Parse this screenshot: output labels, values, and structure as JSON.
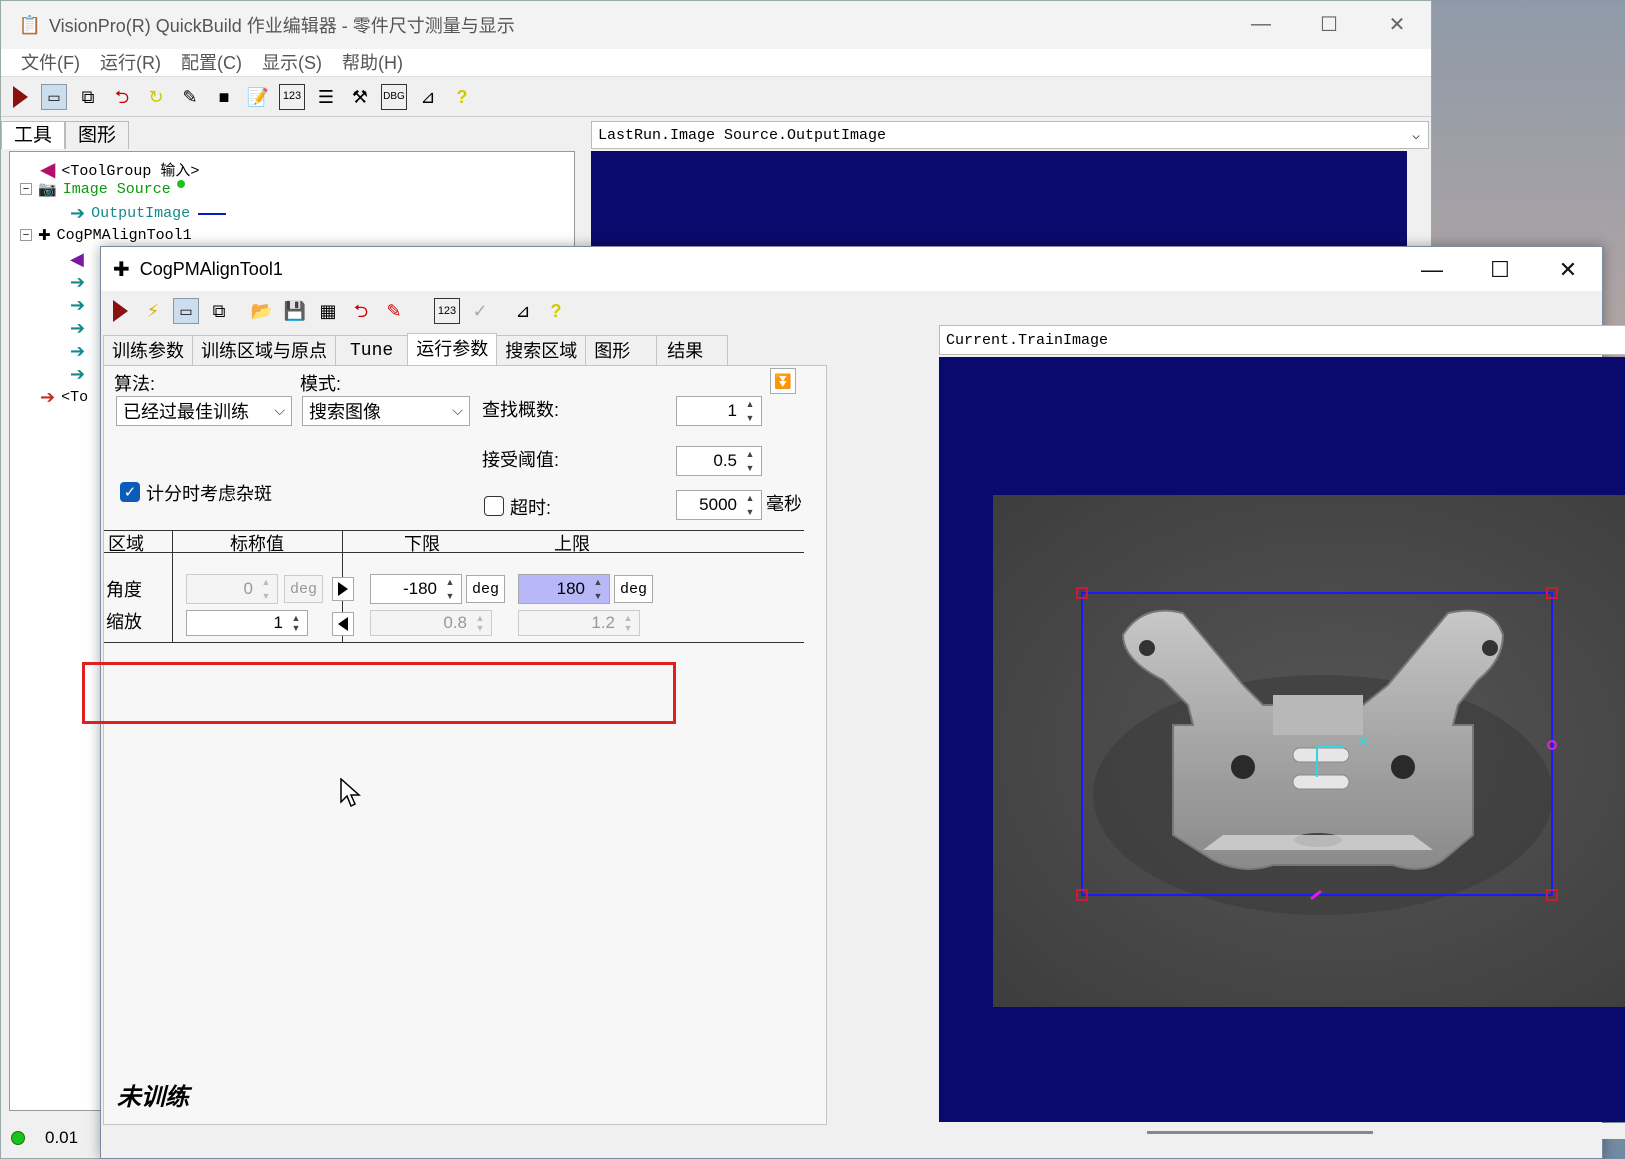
{
  "main_window": {
    "title": "VisionPro(R) QuickBuild 作业编辑器 - 零件尺寸测量与显示",
    "menu": [
      "文件(F)",
      "运行(R)",
      "配置(C)",
      "显示(S)",
      "帮助(H)"
    ],
    "tabs": [
      "工具",
      "图形"
    ],
    "tree": {
      "input": "<ToolGroup 输入>",
      "image_source": "Image Source",
      "output_image": "OutputImage",
      "pmalign": "CogPMAlignTool1",
      "output_stub": "<To"
    },
    "image_selector": "LastRun.Image Source.OutputImage",
    "status_value": "0.01"
  },
  "dialog": {
    "title": "CogPMAlignTool1",
    "tabs": [
      "训练参数",
      "训练区域与原点",
      "Tune",
      "运行参数",
      "搜索区域",
      "图形",
      "结果"
    ],
    "active_tab": "运行参数",
    "algorithm_label": "算法:",
    "algorithm_value": "已经过最佳训练",
    "mode_label": "模式:",
    "mode_value": "搜索图像",
    "find_count_label": "查找概数:",
    "find_count_value": "1",
    "accept_threshold_label": "接受阈值:",
    "accept_threshold_value": "0.5",
    "clutter_label": "计分时考虑杂斑",
    "clutter_checked": true,
    "timeout_label": "超时:",
    "timeout_checked": false,
    "timeout_value": "5000",
    "timeout_unit": "毫秒",
    "zone_headers": [
      "区域",
      "标称值",
      "下限",
      "上限"
    ],
    "rows": [
      {
        "name": "角度",
        "nominal": "0",
        "nominal_unit": "deg",
        "low": "-180",
        "low_unit": "deg",
        "high": "180",
        "high_unit": "deg"
      },
      {
        "name": "缩放",
        "nominal": "1",
        "low": "0.8",
        "high": "1.2"
      }
    ],
    "train_status": "未训练",
    "image_selector": "Current.TrainImage"
  },
  "colors": {
    "navy": "#0a0a6e",
    "highlight": "#e0201e",
    "roi": "#1a1aff",
    "handle": "#cc1a3a",
    "cyan": "#30d6e0",
    "magenta": "#e020e0"
  }
}
